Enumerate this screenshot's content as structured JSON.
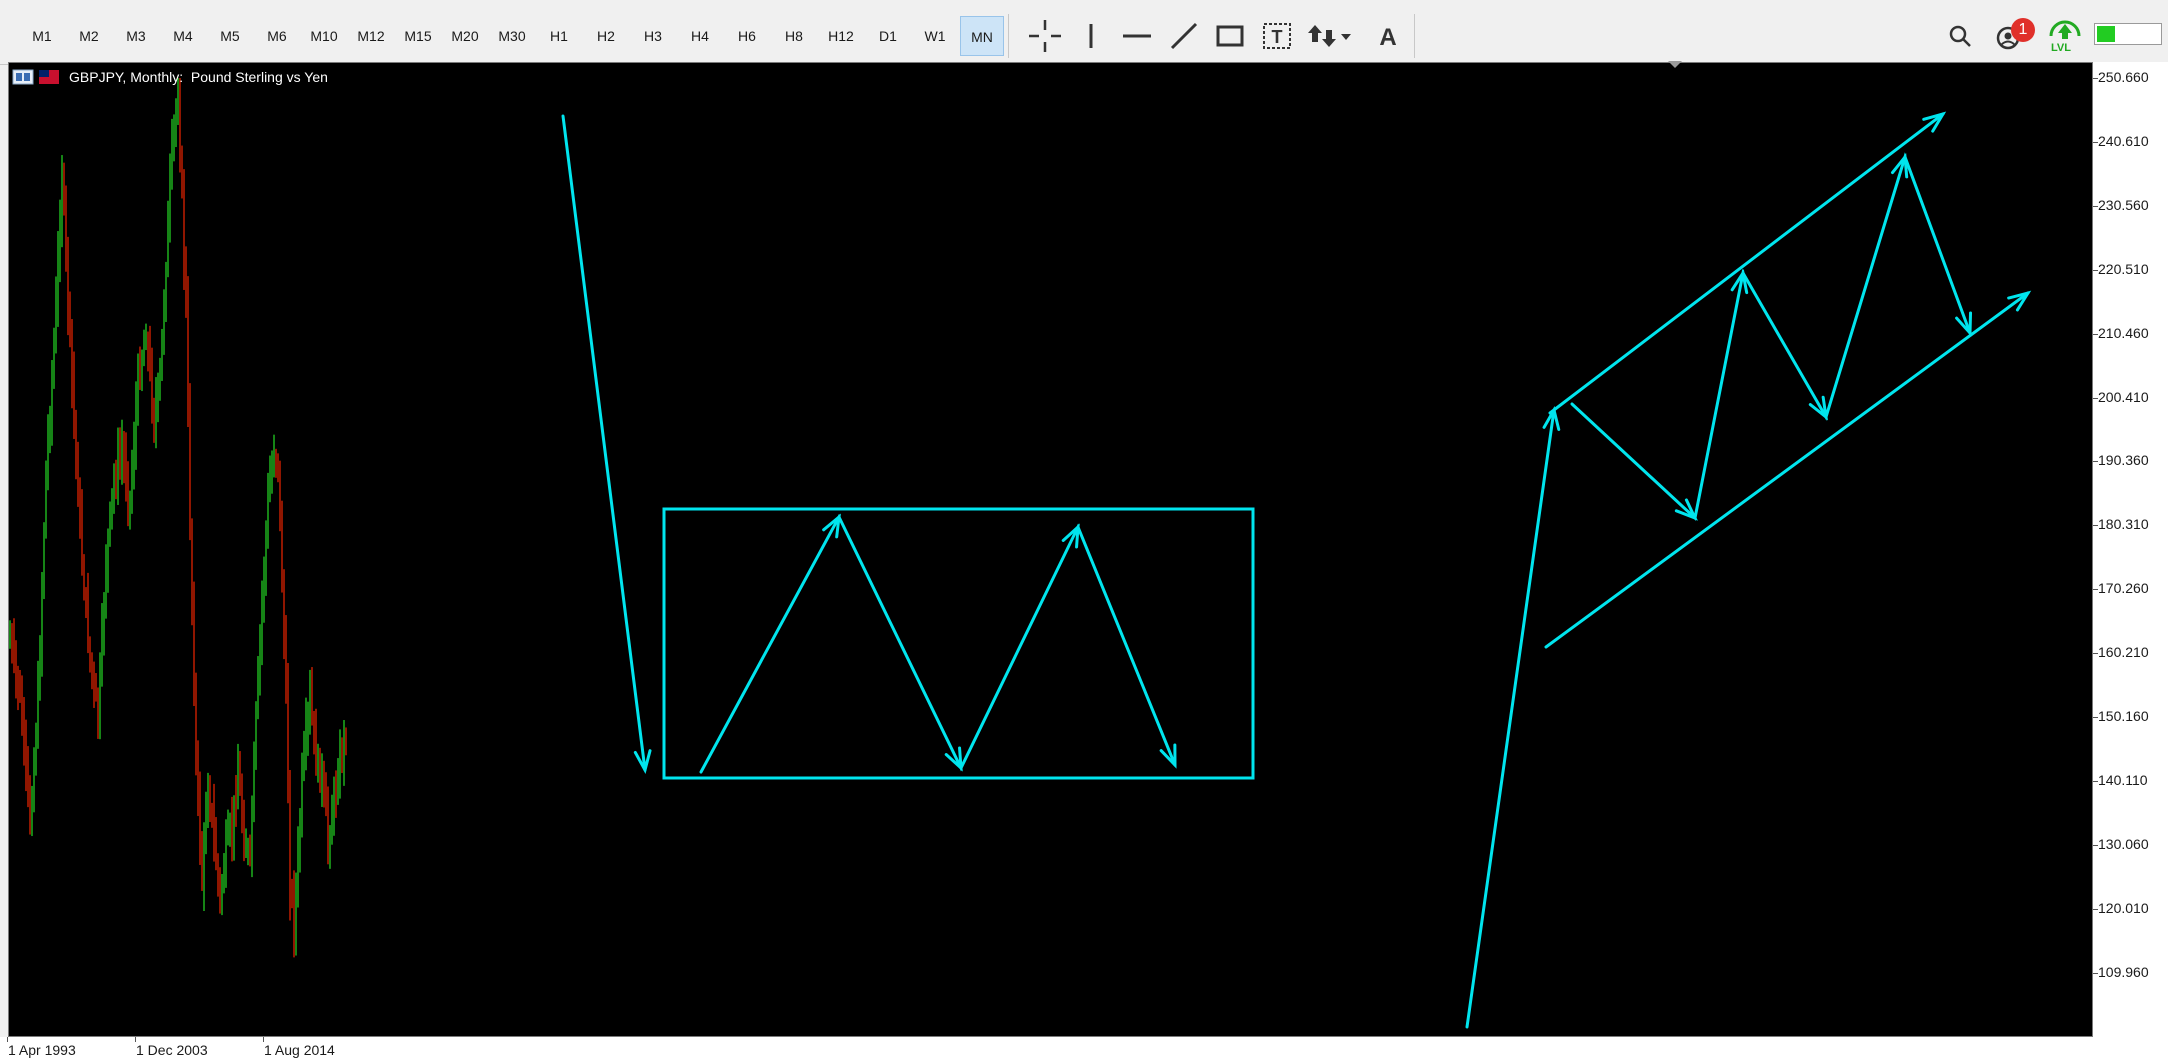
{
  "toolbar": {
    "timeframes": [
      "M1",
      "M2",
      "M3",
      "M4",
      "M5",
      "M6",
      "M10",
      "M12",
      "M15",
      "M20",
      "M30",
      "H1",
      "H2",
      "H3",
      "H4",
      "H6",
      "H8",
      "H12",
      "D1",
      "W1",
      "MN"
    ],
    "active_timeframe": "MN",
    "tools": [
      "crosshair-icon",
      "vertical-line-icon",
      "horizontal-line-icon",
      "trend-line-icon",
      "rectangle-icon",
      "text-label-icon",
      "arrows-icon",
      "text-icon"
    ],
    "notification_count": "1",
    "lvl_label": "LVL"
  },
  "chart": {
    "title": "GBPJPY, Monthly:  Pound Sterling vs Yen",
    "background": "#000000",
    "drawing_color": "#00e5ee",
    "bull_color": "#22cc22",
    "bear_color": "#dd2200"
  },
  "price_scale": [
    "250.660",
    "240.610",
    "230.560",
    "220.510",
    "210.460",
    "200.410",
    "190.360",
    "180.310",
    "170.260",
    "160.210",
    "150.160",
    "140.110",
    "130.060",
    "120.010",
    "109.960"
  ],
  "time_scale": [
    "1 Apr 1993",
    "1 Dec 2003",
    "1 Aug 2014"
  ]
}
